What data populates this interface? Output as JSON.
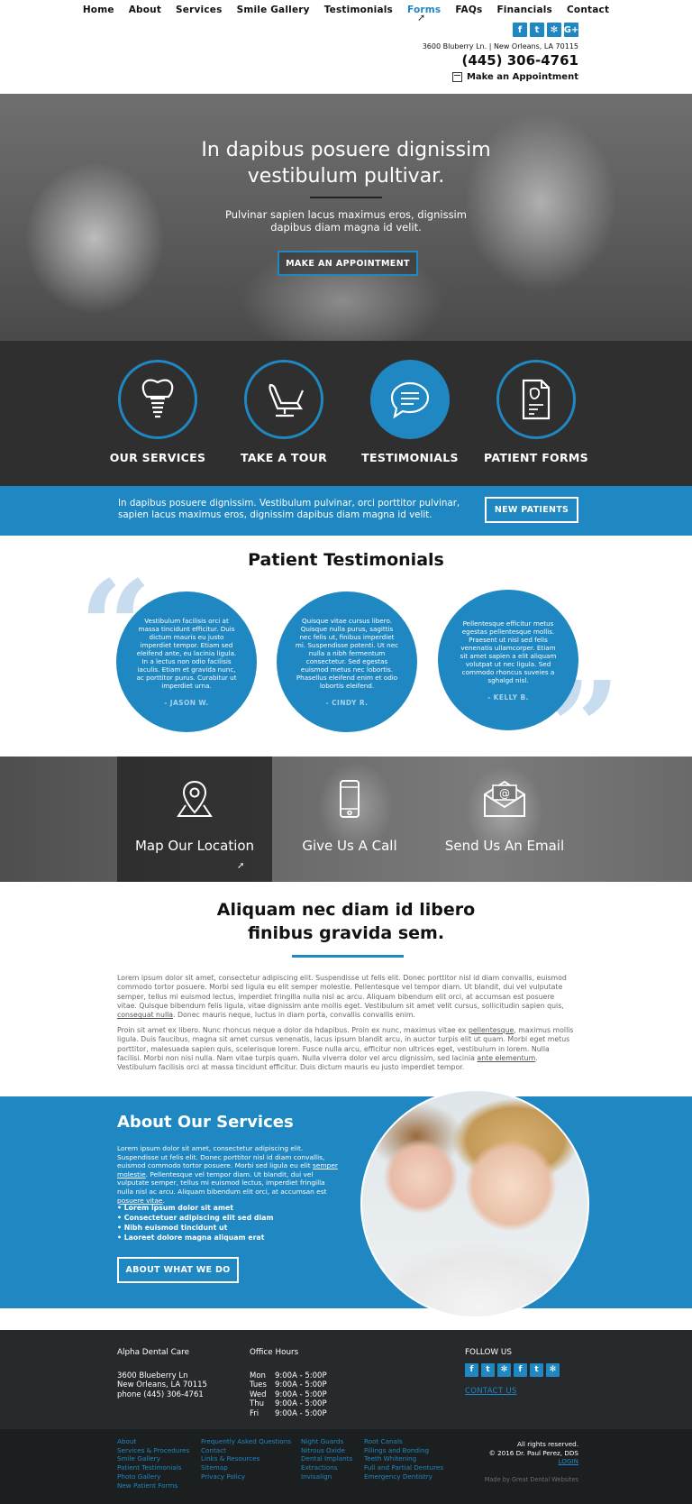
{
  "nav": {
    "items": [
      "Home",
      "About",
      "Services",
      "Smile Gallery",
      "Testimonials",
      "Forms",
      "FAQs",
      "Financials",
      "Contact"
    ],
    "active": "Forms"
  },
  "header": {
    "social": [
      "facebook-icon",
      "twitter-icon",
      "yelp-icon",
      "google-plus-icon"
    ],
    "address": "3600 Bluberry Ln. | New Orleans, LA 70115",
    "phone": "(445) 306-4761",
    "appointment": "Make an Appointment"
  },
  "hero": {
    "title": "In dapibus posuere dignissim vestibulum pultivar.",
    "subtitle": "Pulvinar sapien lacus maximus eros, dignissim dapibus diam magna id velit.",
    "button": "MAKE AN APPOINTMENT"
  },
  "features": [
    {
      "label": "OUR SERVICES",
      "icon": "tooth-implant-icon"
    },
    {
      "label": "TAKE A TOUR",
      "icon": "dental-chair-icon"
    },
    {
      "label": "TESTIMONIALS",
      "icon": "chat-bubble-icon"
    },
    {
      "label": "PATIENT FORMS",
      "icon": "document-form-icon"
    }
  ],
  "strip": {
    "text": "In dapibus posuere dignissim. Vestibulum pulvinar, orci porttitor pulvinar, sapien lacus maximus eros, dignissim dapibus diam magna id velit.",
    "button": "NEW PATIENTS"
  },
  "testimonials": {
    "title": "Patient Testimonials",
    "items": [
      {
        "text": "Vestibulum facilisis orci at massa tincidunt efficitur. Duis dictum mauris eu justo imperdiet tempor. Etiam sed eleifend ante, eu lacinia ligula. In a lectus non odio facilisis iaculis. Etiam et gravida nunc, ac porttitor purus. Curabitur ut imperdiet urna.",
        "author": "- JASON W."
      },
      {
        "text": "Quisque vitae cursus libero. Quisque nulla purus, sagittis nec felis ut, finibus imperdiet mi. Suspendisse potenti. Ut nec nulla a nibh fermentum consectetur. Sed egestas euismod metus nec lobortis. Phasellus eleifend enim et odio lobortis eleifend.",
        "author": "- CINDY R."
      },
      {
        "text": "Pellentesque efficitur metus egestas pellentesque mollis. Praesent ut nisl sed felis venenatis ullamcorper. Etiam sit amet sapien a elit aliquam volutpat ut nec ligula. Sed commodo rhoncus suveies a sghalgd nisl.",
        "author": "- KELLY B."
      }
    ]
  },
  "contact_band": [
    {
      "label": "Map Our Location",
      "icon": "map-pin-icon"
    },
    {
      "label": "Give Us A Call",
      "icon": "phone-icon"
    },
    {
      "label": "Send Us An Email",
      "icon": "email-icon"
    }
  ],
  "article": {
    "title": "Aliquam nec diam id libero finibus gravida sem.",
    "p1": "Lorem ipsum dolor sit amet, consectetur adipiscing elit. Suspendisse ut felis elit. Donec porttitor nisl id diam convallis, euismod commodo tortor posuere. Morbi sed ligula eu elit semper molestie. Pellentesque vel tempor diam. Ut blandit, dui vel vulputate semper, tellus mi euismod lectus, imperdiet fringilla nulla nisl ac arcu. Aliquam bibendum elit orci, at accumsan est posuere vitae. Quisque bibendum felis ligula, vitae dignissim ante mollis eget. Vestibulum sit amet velit cursus, sollicitudin sapien quis,",
    "p1_link": "consequat nulla",
    "p1_end": ". Donec mauris neque, luctus in diam porta, convallis convallis enim.",
    "p2": "Proin sit amet ex libero. Nunc rhoncus neque a dolor da hdapibus. Proin ex nunc, maximus vitae ex",
    "p2_link1": "pellentesque",
    "p2_mid": ", maximus mollis ligula. Duis faucibus, magna sit amet cursus venenatis, lacus ipsum blandit arcu, in auctor turpis elit ut quam. Morbi eget metus porttitor, malesuada sapien quis, scelerisque lorem. Fusce nulla arcu, efficitur non ultrices eget, vestibulum in lorem. Nulla facilisi. Morbi non nisi nulla. Nam vitae turpis quam. Nulla viverra dolor vel arcu dignissim, sed lacinia",
    "p2_link2": "ante elementum",
    "p2_end": ". Vestibulum facilisis orci at massa tincidunt efficitur. Duis dictum mauris eu justo imperdiet tempor."
  },
  "services": {
    "title": "About Our Services",
    "p_a": "Lorem ipsum dolor sit amet, consectetur adipiscing elit. Suspendisse ut felis elit. Donec porttitor nisl id diam convallis, euismod commodo tortor posuere. Morbi sed ligula eu elit",
    "p_link1": "semper molestie",
    "p_b": ". Pellentesque vel tempor diam. Ut blandit, dui vel vulputate semper, tellus mi euismod lectus, imperdiet fringilla nulla nisl ac arcu. Aliquam bibendum elit orci, at accumsan est",
    "p_link2": "posuere vitae",
    "p_c": ".",
    "list": [
      "Lorem ipsum dolor sit amet",
      "Consectetuer adipiscing elit sed diam",
      "Nibh euismod tincidunt ut",
      "Laoreet dolore magna aliquam erat"
    ],
    "button": "ABOUT WHAT WE DO"
  },
  "footer": {
    "practice": "Alpha Dental Care",
    "address1": "3600 Blueberry Ln",
    "address2": "New Orleans, LA 70115",
    "phone": "phone (445) 306-4761",
    "hours_title": "Office Hours",
    "hours": [
      {
        "day": "Mon",
        "time": "9:00A - 5:00P"
      },
      {
        "day": "Tues",
        "time": "9:00A - 5:00P"
      },
      {
        "day": "Wed",
        "time": "9:00A - 5:00P"
      },
      {
        "day": "Thu",
        "time": "9:00A - 5:00P"
      },
      {
        "day": "Fri",
        "time": "9:00A - 5:00P"
      }
    ],
    "follow": "FOLLOW US",
    "social": [
      "facebook-icon",
      "twitter-icon",
      "yelp-icon",
      "facebook-icon",
      "twitter-icon",
      "yelp-icon"
    ],
    "contact_link": "CONTACT US",
    "links_col1": [
      "About",
      "Services & Procedures",
      "Smile Gallery",
      "Patient Testimonials",
      "Photo Gallery",
      "New Patient Forms"
    ],
    "links_col2": [
      "Frequently Asked Questions",
      "Contact",
      "Links & Resources",
      "Sitemap",
      "Privacy Policy"
    ],
    "links_col3": [
      "Night Guards",
      "Nitrous Oxide",
      "Dental Implants",
      "Extractions",
      "Invisalign"
    ],
    "links_col4": [
      "Root Canals",
      "Fillings and Bonding",
      "Teeth Whitening",
      "Full and Partial Dentures",
      "Emergency Dentistry"
    ],
    "rights": "All rights reserved.",
    "copyright": "© 2016 Dr. Paul Perez, DDS",
    "login": "LOGIN",
    "made_by": "Made by Great Dental Websites"
  },
  "colors": {
    "accent": "#1f87c1",
    "dark": "#2f2f2f",
    "footer": "#262a2c"
  }
}
